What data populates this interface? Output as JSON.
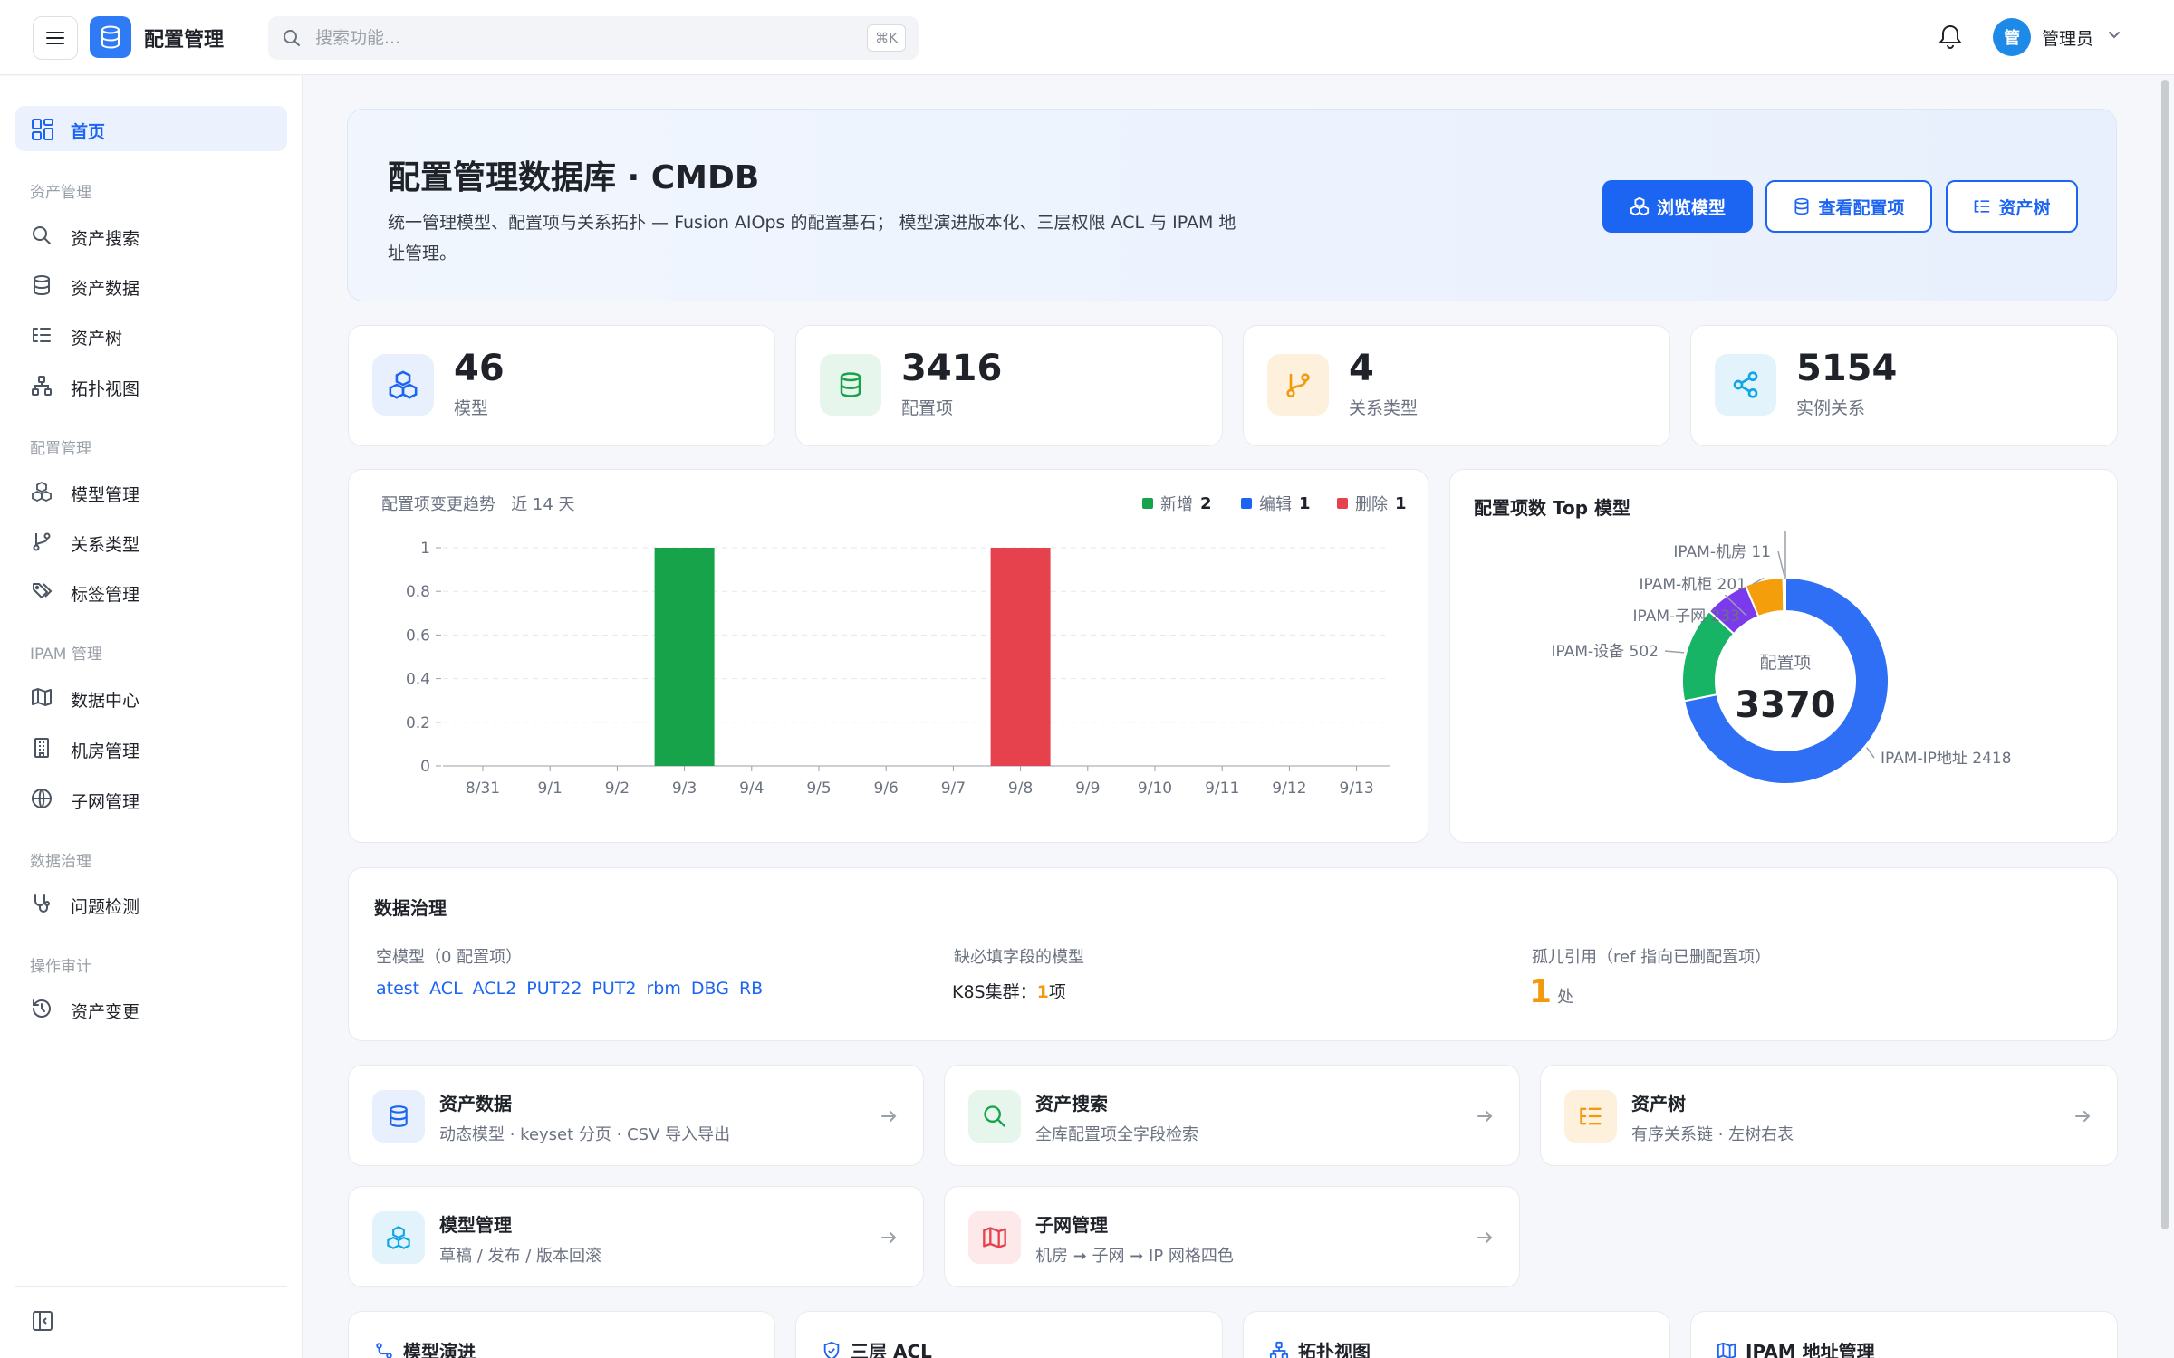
{
  "topbar": {
    "app_title": "配置管理",
    "search_placeholder": "搜索功能...",
    "shortcut": "⌘K",
    "user_initial": "管",
    "user_name": "管理员"
  },
  "sidebar": {
    "home": "首页",
    "sections": [
      {
        "title": "资产管理",
        "items": [
          "资产搜索",
          "资产数据",
          "资产树",
          "拓扑视图"
        ]
      },
      {
        "title": "配置管理",
        "items": [
          "模型管理",
          "关系类型",
          "标签管理"
        ]
      },
      {
        "title": "IPAM 管理",
        "items": [
          "数据中心",
          "机房管理",
          "子网管理"
        ]
      },
      {
        "title": "数据治理",
        "items": [
          "问题检测"
        ]
      },
      {
        "title": "操作审计",
        "items": [
          "资产变更"
        ]
      }
    ]
  },
  "hero": {
    "title": "配置管理数据库 · CMDB",
    "description": "统一管理模型、配置项与关系拓扑 — Fusion AIOps 的配置基石； 模型演进版本化、三层权限 ACL 与 IPAM 地址管理。",
    "buttons": [
      "浏览模型",
      "查看配置项",
      "资产树"
    ]
  },
  "stats": [
    {
      "value": "46",
      "label": "模型",
      "color": "#1c64f2"
    },
    {
      "value": "3416",
      "label": "配置项",
      "color": "#16a34a"
    },
    {
      "value": "4",
      "label": "关系类型",
      "color": "#f29a0c"
    },
    {
      "value": "5154",
      "label": "实例关系",
      "color": "#0ea5e9"
    }
  ],
  "trend": {
    "title": "配置项变更趋势",
    "period": "近 14 天",
    "legend": [
      {
        "name": "新增",
        "count": "2",
        "color": "#16a34a"
      },
      {
        "name": "编辑",
        "count": "1",
        "color": "#1c64f2"
      },
      {
        "name": "删除",
        "count": "1",
        "color": "#e5424d"
      }
    ]
  },
  "donut": {
    "title": "配置项数 Top 模型",
    "center_label": "配置项",
    "center_value": "3370"
  },
  "chart_data": [
    {
      "type": "bar",
      "title": "配置项变更趋势",
      "categories": [
        "8/31",
        "9/1",
        "9/2",
        "9/3",
        "9/4",
        "9/5",
        "9/6",
        "9/7",
        "9/8",
        "9/9",
        "9/10",
        "9/11",
        "9/12",
        "9/13"
      ],
      "series": [
        {
          "name": "新增",
          "color": "#16a34a",
          "values": [
            0,
            0,
            0,
            1,
            0,
            0,
            0,
            0,
            0,
            0,
            0,
            0,
            0,
            0
          ]
        },
        {
          "name": "编辑",
          "color": "#1c64f2",
          "values": [
            0,
            0,
            0,
            0,
            0,
            0,
            0,
            0,
            0,
            0,
            0,
            0,
            0,
            0
          ]
        },
        {
          "name": "删除",
          "color": "#e5424d",
          "values": [
            0,
            0,
            0,
            0,
            0,
            0,
            0,
            0,
            1,
            0,
            0,
            0,
            0,
            0
          ]
        }
      ],
      "ylim": [
        0,
        1
      ],
      "yticks": [
        "1",
        "0.8",
        "0.6",
        "0.4",
        "0.2",
        "0"
      ],
      "grid": true
    },
    {
      "type": "pie",
      "title": "配置项数 Top 模型",
      "slices": [
        {
          "label": "IPAM-IP地址",
          "value": 2418,
          "color": "#2f6ff6"
        },
        {
          "label": "IPAM-设备",
          "value": 502,
          "color": "#16b464"
        },
        {
          "label": "IPAM-子网",
          "value": 233,
          "color": "#7c3aed"
        },
        {
          "label": "IPAM-机柜",
          "value": 201,
          "color": "#f59e0b"
        },
        {
          "label": "IPAM-机房",
          "value": 11,
          "color": "#64748b"
        }
      ]
    }
  ],
  "governance": {
    "title": "数据治理",
    "empty_models_label": "空模型（0 配置项）",
    "empty_models": [
      "atest",
      "ACL",
      "ACL2",
      "PUT22",
      "PUT2",
      "rbm",
      "DBG",
      "RB"
    ],
    "missing_label": "缺必填字段的模型",
    "missing_model": "K8S集群：",
    "missing_count": "1",
    "missing_unit": "项",
    "orphan_label": "孤儿引用（ref 指向已删配置项）",
    "orphan_count": "1",
    "orphan_unit": "处"
  },
  "quick_cards": [
    {
      "title": "资产数据",
      "sub": "动态模型 · keyset 分页 · CSV 导入导出"
    },
    {
      "title": "资产搜索",
      "sub": "全库配置项全字段检索"
    },
    {
      "title": "资产树",
      "sub": "有序关系链 · 左树右表"
    },
    {
      "title": "模型管理",
      "sub": "草稿 / 发布 / 版本回滚"
    },
    {
      "title": "子网管理",
      "sub": "机房 ➞ 子网 ➞ IP 网格四色"
    }
  ],
  "bottom_cards": [
    "模型演进",
    "三层 ACL",
    "拓扑视图",
    "IPAM 地址管理"
  ]
}
